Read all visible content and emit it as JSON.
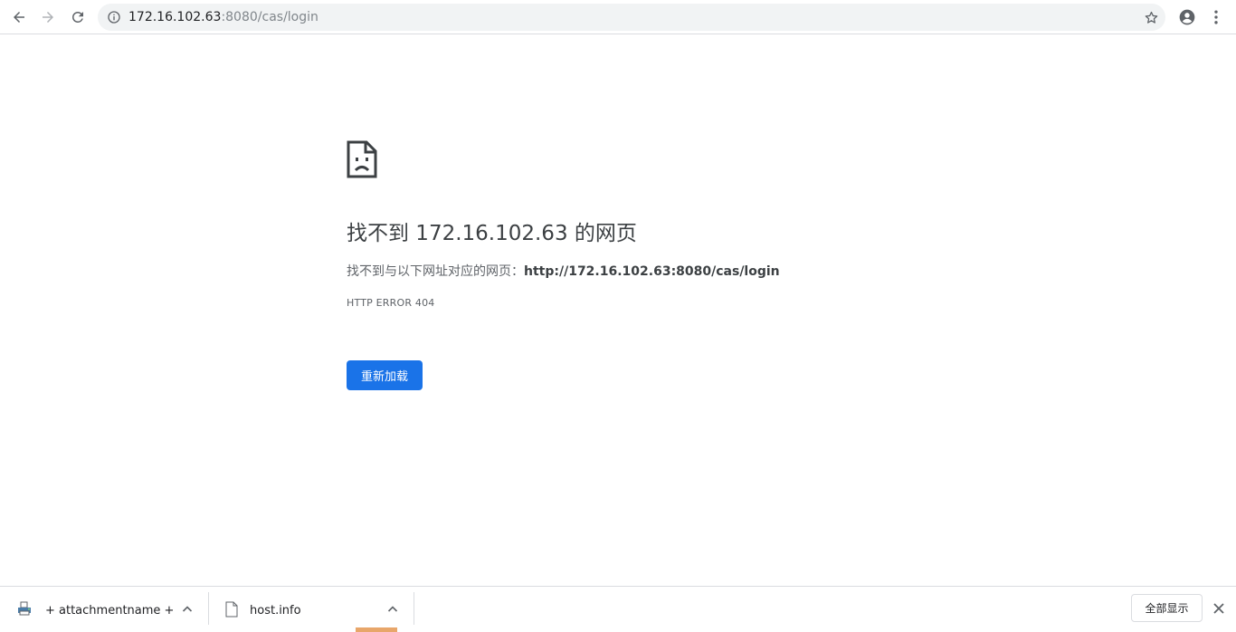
{
  "browser": {
    "url_host": "172.16.102.63",
    "url_path": ":8080/cas/login",
    "icons": {
      "back": "back-arrow-icon",
      "forward": "forward-arrow-icon",
      "reload": "reload-icon",
      "site_info": "info-icon",
      "bookmark": "star-icon",
      "profile": "account-circle-icon",
      "menu": "vertical-dots-icon"
    }
  },
  "error_page": {
    "icon": "sad-document-icon",
    "title": "找不到 172.16.102.63 的网页",
    "description_prefix": "找不到与以下网址对应的网页：",
    "description_url": "http://172.16.102.63:8080/cas/login",
    "error_code": "HTTP ERROR 404",
    "reload_label": "重新加载",
    "reload_color": "#1a73e8"
  },
  "download_shelf": {
    "items": [
      {
        "name": "+ attachmentname +",
        "icon": "printer-file-icon"
      },
      {
        "name": "host.info",
        "icon": "file-icon"
      }
    ],
    "show_all_label": "全部显示",
    "close_icon": "close-icon"
  }
}
